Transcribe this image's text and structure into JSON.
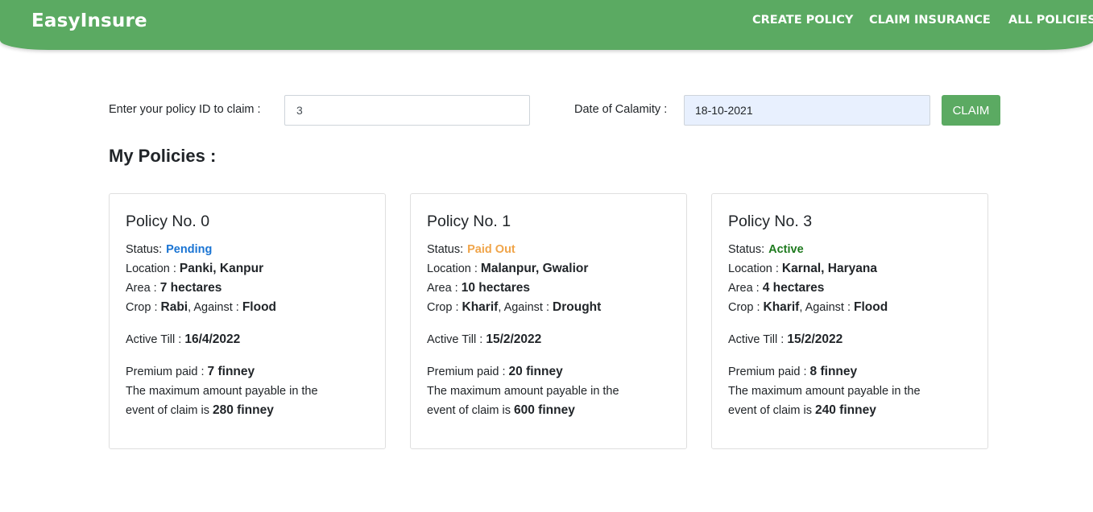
{
  "nav": {
    "brand": "EasyInsure",
    "links": [
      "CREATE POLICY",
      "CLAIM INSURANCE",
      "ALL POLICIES"
    ]
  },
  "claim_form": {
    "policy_label": "Enter your policy ID to claim :",
    "policy_value": "3",
    "date_label": "Date of Calamity :",
    "date_value": "18-10-2021",
    "button_label": "CLAIM"
  },
  "section_title": "My Policies :",
  "labels": {
    "status": "Status:",
    "location": "Location : ",
    "area": "Area : ",
    "crop": "Crop : ",
    "against": ", Against : ",
    "active_till": "Active Till : ",
    "premium": "Premium paid : ",
    "max_payable": "The maximum amount payable in the",
    "event_claim": "event of claim is "
  },
  "colors": {
    "brand_green": "#5baa62",
    "pending": "#1a74d3",
    "paid_out": "#f0a54a",
    "active": "#1e7a1e"
  },
  "policies": [
    {
      "title": "Policy No. 0",
      "status": "Pending",
      "location": "Panki, Kanpur",
      "area": "7 hectares",
      "crop": "Rabi",
      "against": "Flood",
      "active_till": "16/4/2022",
      "premium": "7 finney",
      "max_amount": "280 finney"
    },
    {
      "title": "Policy No. 1",
      "status": "Paid Out",
      "location": "Malanpur, Gwalior",
      "area": "10 hectares",
      "crop": "Kharif",
      "against": "Drought",
      "active_till": "15/2/2022",
      "premium": "20 finney",
      "max_amount": "600 finney"
    },
    {
      "title": "Policy No. 3",
      "status": "Active",
      "location": "Karnal, Haryana",
      "area": "4 hectares",
      "crop": "Kharif",
      "against": "Flood",
      "active_till": "15/2/2022",
      "premium": "8 finney",
      "max_amount": "240 finney"
    }
  ]
}
